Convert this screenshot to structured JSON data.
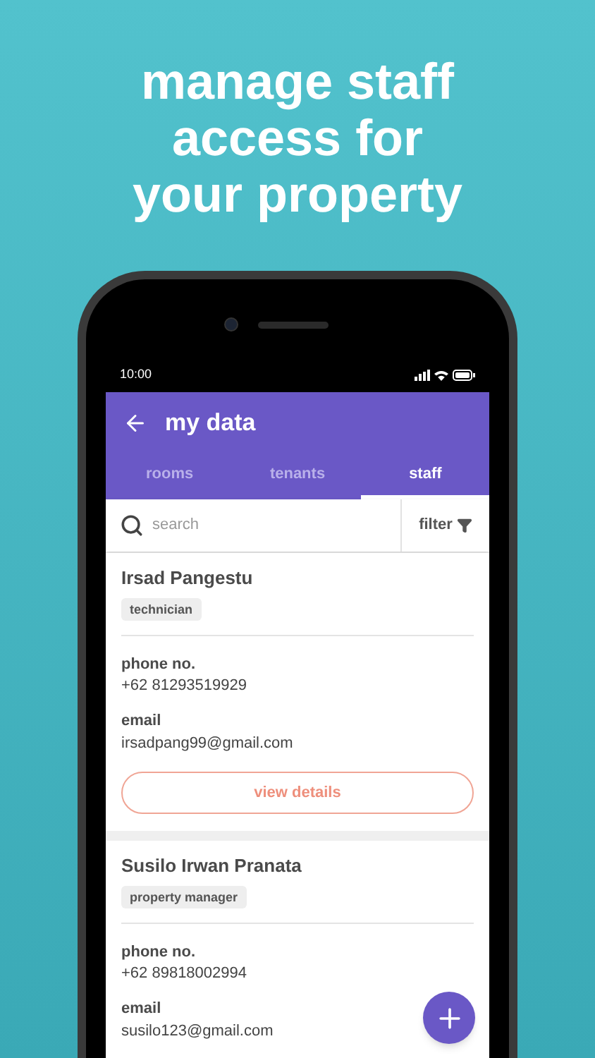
{
  "headline": "manage staff access for your property",
  "status_bar": {
    "time": "10:00"
  },
  "app_bar": {
    "title": "my data"
  },
  "tabs": [
    {
      "label": "rooms",
      "selected": false
    },
    {
      "label": "tenants",
      "selected": false
    },
    {
      "label": "staff",
      "selected": true
    }
  ],
  "search": {
    "placeholder": "search"
  },
  "filter": {
    "label": "filter"
  },
  "staff": [
    {
      "name": "Irsad Pangestu",
      "role": "technician",
      "phone_label": "phone no.",
      "phone": "+62 81293519929",
      "email_label": "email",
      "email": "irsadpang99@gmail.com",
      "button": "view details"
    },
    {
      "name": "Susilo Irwan Pranata",
      "role": "property manager",
      "phone_label": "phone no.",
      "phone": "+62 89818002994",
      "email_label": "email",
      "email": "susilo123@gmail.com"
    }
  ]
}
